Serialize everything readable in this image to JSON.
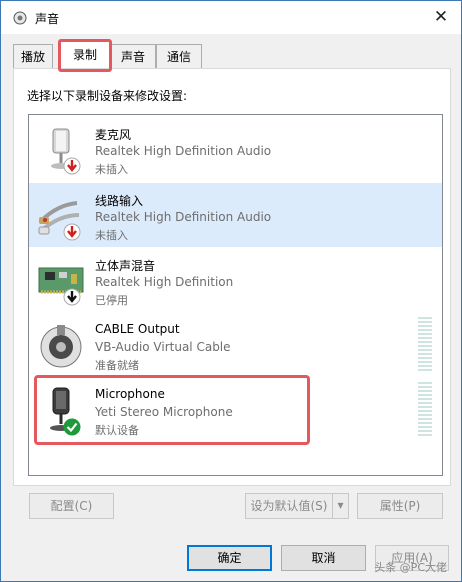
{
  "window": {
    "title": "声音"
  },
  "tabs": [
    {
      "label": "播放"
    },
    {
      "label": "录制"
    },
    {
      "label": "声音"
    },
    {
      "label": "通信"
    }
  ],
  "instruction": "选择以下录制设备来修改设置:",
  "devices": [
    {
      "name": "麦克风",
      "description": "Realtek High Definition Audio",
      "status": "未插入",
      "icon": "microphone-icon",
      "badge": "red-down-arrow"
    },
    {
      "name": "线路输入",
      "description": "Realtek High Definition Audio",
      "status": "未插入",
      "icon": "line-in-cable-icon",
      "badge": "red-down-arrow",
      "selected": true
    },
    {
      "name": "立体声混音",
      "description": "Realtek High Definition",
      "status": "已停用",
      "icon": "sound-card-icon",
      "badge": "black-down-arrow"
    },
    {
      "name": "CABLE Output",
      "description": "VB-Audio Virtual Cable",
      "status": "准备就绪",
      "icon": "cable-output-icon"
    },
    {
      "name": "Microphone",
      "description": "Yeti Stereo Microphone",
      "status": "默认设备",
      "icon": "microphone-icon",
      "badge": "green-check"
    }
  ],
  "buttons": {
    "configure": "配置(C)",
    "set_default": "设为默认值(S)",
    "properties": "属性(P)",
    "ok": "确定",
    "cancel": "取消",
    "apply": "应用(A)"
  },
  "watermark": "头条 @PC大佬",
  "colors": {
    "highlight": "#e5585e",
    "selected_row": "#dcebfc",
    "accent": "#0078d7"
  }
}
